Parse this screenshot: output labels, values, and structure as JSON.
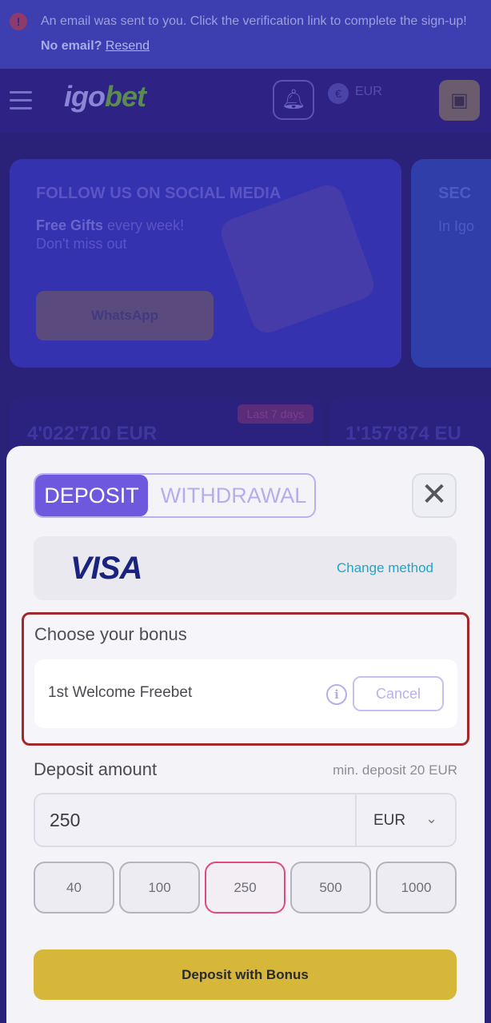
{
  "notice": {
    "text": "An email was sent to you. Click the verification link to complete the sign-up!",
    "no_email": "No email?",
    "resend": "Resend"
  },
  "header": {
    "logo_part1": "igo",
    "logo_part2": "bet",
    "currency": "EUR"
  },
  "banner": {
    "title": "FOLLOW US ON SOCIAL MEDIA",
    "text_bold": "Free Gifts",
    "text_rest": " every week!",
    "text_line2": "Don't miss out",
    "button": "WhatsApp"
  },
  "banner2": {
    "title": "SEC",
    "text": "In Igo"
  },
  "stats": {
    "badge": "Last 7 days",
    "value1": "4'022'710 EUR",
    "value2": "1'157'874 EU"
  },
  "modal": {
    "tabs": {
      "deposit": "DEPOSIT",
      "withdrawal": "WITHDRAWAL"
    },
    "method": {
      "brand": "VISA",
      "change_label": "Change method"
    },
    "bonus": {
      "title": "Choose your bonus",
      "name": "1st Welcome Freebet",
      "cancel_label": "Cancel"
    },
    "amount": {
      "label": "Deposit amount",
      "min_note": "min. deposit 20 EUR",
      "value": "250",
      "currency": "EUR",
      "presets": [
        "40",
        "100",
        "250",
        "500",
        "1000"
      ],
      "selected_preset": "250"
    },
    "submit_label": "Deposit with Bonus"
  },
  "colors": {
    "accent": "#6e58dd",
    "highlight_frame": "#a3282c",
    "submit": "#d6b739",
    "link": "#1da6c9"
  }
}
